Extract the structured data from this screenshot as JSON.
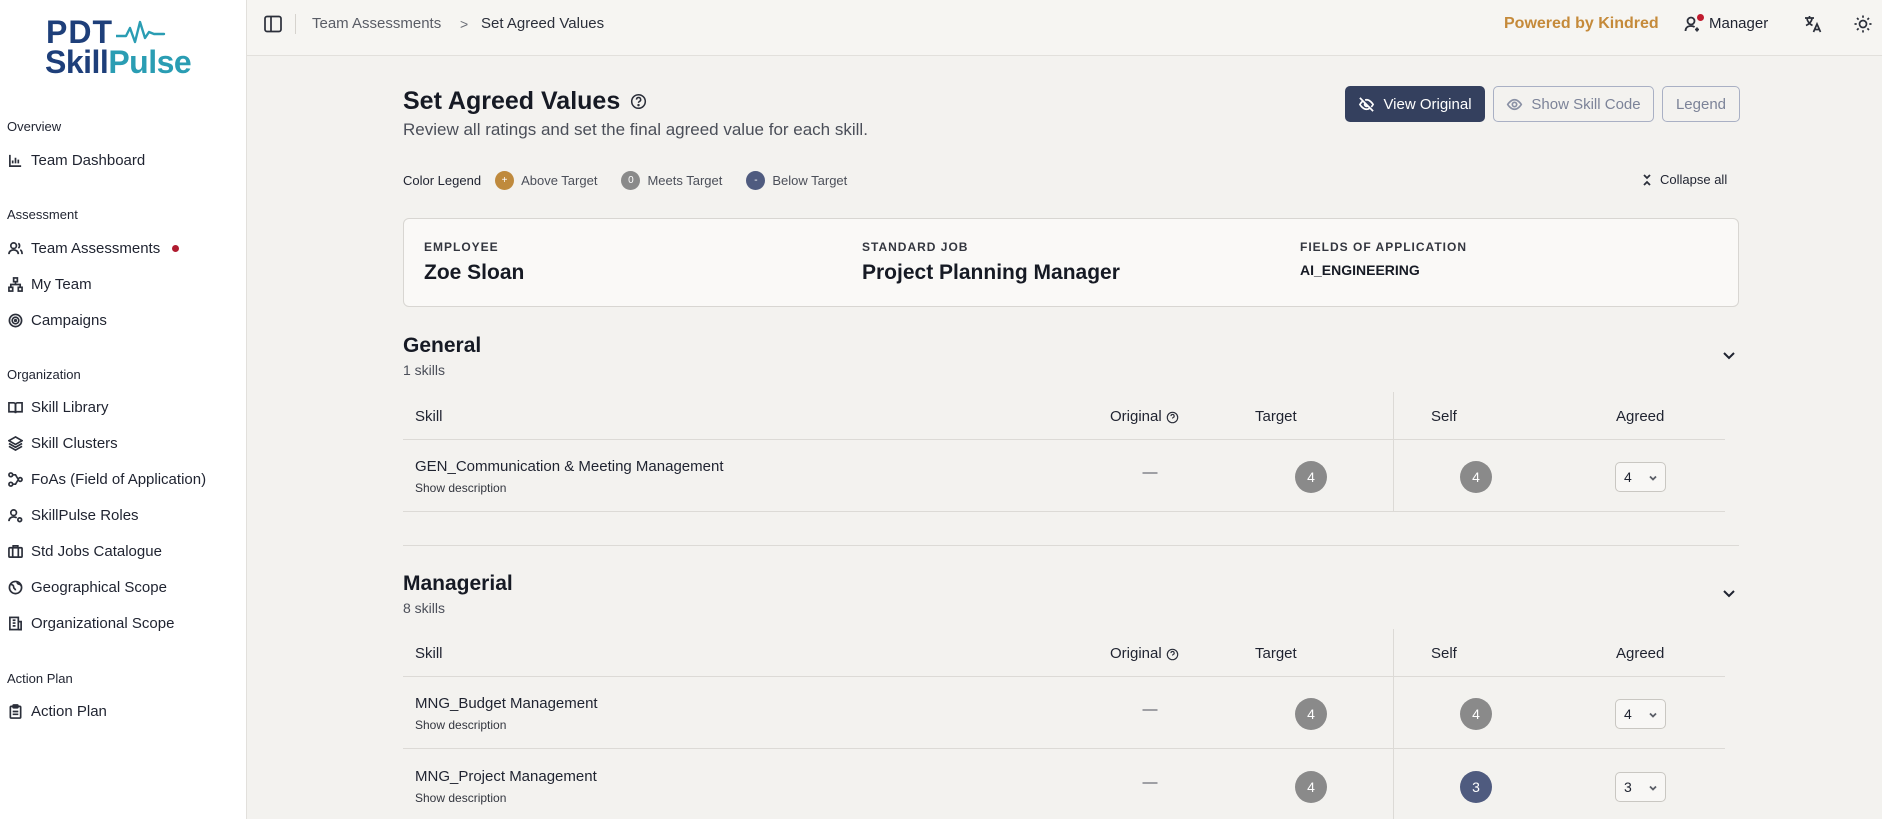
{
  "app": {
    "logo_line1": "PDT",
    "logo_line2a": "Skill",
    "logo_line2b": "Pulse"
  },
  "sidebar": {
    "sections": [
      {
        "title": "Overview"
      },
      {
        "title": "Assessment"
      },
      {
        "title": "Organization"
      },
      {
        "title": "Action Plan"
      }
    ],
    "items": [
      {
        "label": "Team Dashboard",
        "icon": "bar-chart-icon"
      },
      {
        "label": "Team Assessments",
        "icon": "users-icon",
        "notification": true
      },
      {
        "label": "My Team",
        "icon": "hierarchy-icon"
      },
      {
        "label": "Campaigns",
        "icon": "target-icon"
      },
      {
        "label": "Skill Library",
        "icon": "book-icon"
      },
      {
        "label": "Skill Clusters",
        "icon": "layers-icon"
      },
      {
        "label": "FoAs (Field of Application)",
        "icon": "workflow-icon"
      },
      {
        "label": "SkillPulse Roles",
        "icon": "user-roles-icon"
      },
      {
        "label": "Std Jobs Catalogue",
        "icon": "briefcase-icon"
      },
      {
        "label": "Geographical Scope",
        "icon": "globe-icon"
      },
      {
        "label": "Organizational Scope",
        "icon": "building-icon"
      },
      {
        "label": "Action Plan",
        "icon": "clipboard-icon"
      }
    ]
  },
  "topbar": {
    "breadcrumb": [
      "Team Assessments",
      "Set Agreed Values"
    ],
    "breadcrumb_sep": ">",
    "powered_by": "Powered by Kindred",
    "role": "Manager"
  },
  "page": {
    "title": "Set Agreed Values",
    "subtitle": "Review all ratings and set the final agreed value for each skill.",
    "buttons": {
      "view_original": "View Original",
      "show_skill_code": "Show Skill Code",
      "legend": "Legend"
    },
    "legend": {
      "title": "Color Legend",
      "items": [
        {
          "symbol": "+",
          "label": "Above Target",
          "color": "#bf8a3d"
        },
        {
          "symbol": "0",
          "label": "Meets Target",
          "color": "#8a8a8a"
        },
        {
          "symbol": "-",
          "label": "Below Target",
          "color": "#4f5b7f"
        }
      ]
    },
    "collapse_all": "Collapse all"
  },
  "employee": {
    "employee_label": "EMPLOYEE",
    "employee_value": "Zoe Sloan",
    "job_label": "STANDARD JOB",
    "job_value": "Project Planning Manager",
    "foa_label": "FIELDS OF APPLICATION",
    "foa_value": "AI_ENGINEERING"
  },
  "table_headers": {
    "skill": "Skill",
    "original": "Original",
    "target": "Target",
    "self": "Self",
    "agreed": "Agreed"
  },
  "sections": [
    {
      "title": "General",
      "count": "1 skills",
      "rows": [
        {
          "skill": "GEN_Communication & Meeting Management",
          "desc": "Show description",
          "original": "—",
          "target": "4",
          "self": "4",
          "agreed": "4"
        }
      ]
    },
    {
      "title": "Managerial",
      "count": "8 skills",
      "rows": [
        {
          "skill": "MNG_Budget Management",
          "desc": "Show description",
          "original": "—",
          "target": "4",
          "self": "4",
          "agreed": "4"
        },
        {
          "skill": "MNG_Project Management",
          "desc": "Show description",
          "original": "—",
          "target": "4",
          "self": "3",
          "agreed": "3"
        }
      ]
    }
  ]
}
